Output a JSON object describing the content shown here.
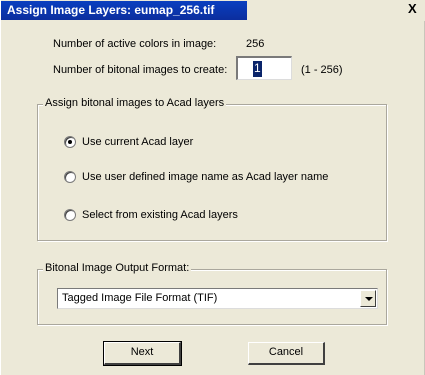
{
  "window": {
    "title": "Assign Image Layers: eumap_256.tif",
    "close_glyph": "X"
  },
  "info": {
    "active_colors_label": "Number of active colors in image:",
    "active_colors_value": "256",
    "bitonal_count_label": "Number of bitonal images to create:",
    "bitonal_count_value": "1",
    "bitonal_count_range": "(1 - 256)"
  },
  "assign_group": {
    "legend": "Assign bitonal images to Acad layers",
    "options": [
      {
        "label": "Use current Acad layer",
        "selected": true
      },
      {
        "label": "Use user defined image name as Acad layer name",
        "selected": false
      },
      {
        "label": "Select from existing Acad layers",
        "selected": false
      }
    ]
  },
  "output_group": {
    "legend": "Bitonal Image Output Format:",
    "selected_format": "Tagged Image File Format (TIF)"
  },
  "buttons": {
    "next": "Next",
    "cancel": "Cancel"
  }
}
